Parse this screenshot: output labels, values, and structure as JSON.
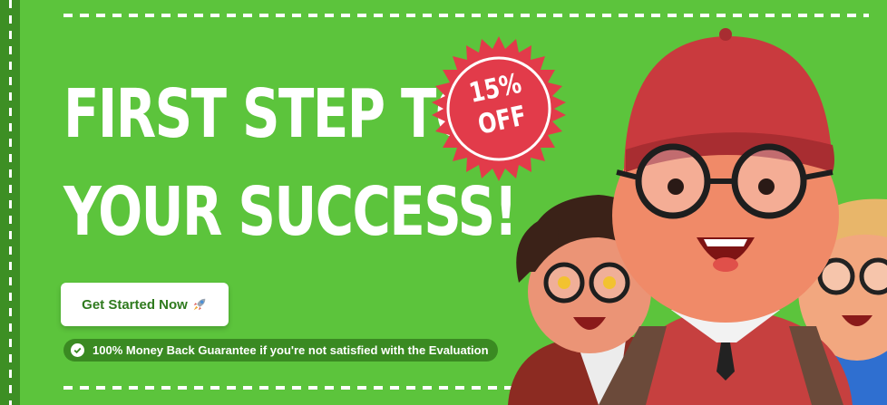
{
  "headline": {
    "line1": "FIRST STEP TO",
    "line2": "YOUR SUCCESS!"
  },
  "badge": {
    "line1": "15%",
    "line2": "OFF"
  },
  "cta": {
    "label": "Get Started Now",
    "icon": "rocket-icon"
  },
  "guarantee": {
    "icon": "check-circle-icon",
    "text": "100% Money Back Guarantee if you're not satisfied with the Evaluation"
  },
  "colors": {
    "background": "#5cc43c",
    "left_strip": "#3d8f24",
    "badge": "#e23b4a",
    "cta_text": "#2f7a1e",
    "guarantee_bg": "#3a8a22"
  }
}
